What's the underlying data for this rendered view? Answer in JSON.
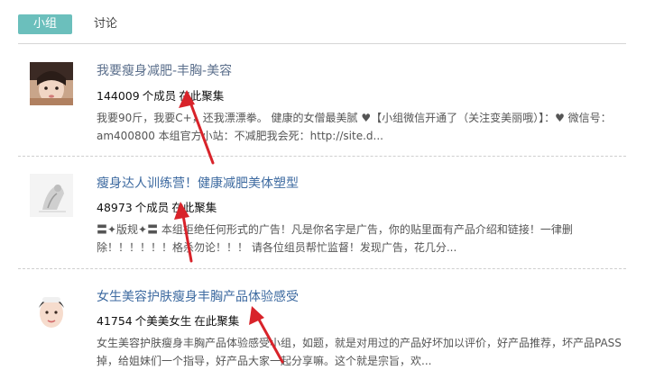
{
  "tabs": {
    "groups_label": "小组",
    "discussion_label": "讨论"
  },
  "groups": [
    {
      "title": "我要瘦身减肥-丰胸-美容",
      "member_count": "144009",
      "member_unit": "个成员",
      "member_tail": "在此聚集",
      "description": "我要90斤，我要C+，还我漂漂拳。 健康的女僧最美腻 ♥【小组微信开通了（关注变美丽哦）】：♥ 微信号：am400800 本组官方小站：不减肥我会死：http://site.d..."
    },
    {
      "title": "瘦身达人训练营！健康减肥美体塑型",
      "member_count": "48973",
      "member_unit": "个成员",
      "member_tail": "在此聚集",
      "description": "〓✦版规✦〓 本组拒绝任何形式的广告！凡是你名字是广告，你的贴里面有产品介绍和链接！一律删除！！！！！！格杀勿论！！！ 请各位组员帮忙监督！发现广告，花几分..."
    },
    {
      "title": "女生美容护肤瘦身丰胸产品体验感受",
      "member_count": "41754",
      "member_unit": "个美美女生",
      "member_tail": "在此聚集",
      "description": "女生美容护肤瘦身丰胸产品体验感受小组，如题，就是对用过的产品好坏加以评价，好产品推荐，坏产品PASS掉，给姐妹们一个指导，好产品大家一起分享嘛。这个就是宗旨，欢..."
    }
  ],
  "colors": {
    "tab_active": "#6bbfbc",
    "link": "#3d6aa0",
    "arrow": "#d8232a"
  }
}
